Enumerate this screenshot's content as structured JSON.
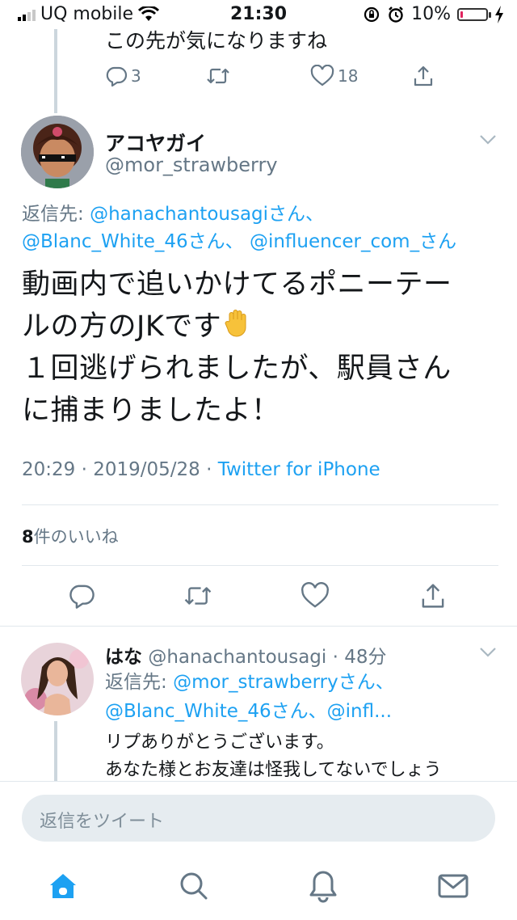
{
  "status_bar": {
    "carrier": "UQ mobile",
    "time": "21:30",
    "battery": "10%",
    "battery_level": 0.1
  },
  "prev_tweet": {
    "text": "この先が気になりますね",
    "reply_count": "3",
    "like_count": "18"
  },
  "main_tweet": {
    "display_name": "アコヤガイ",
    "handle": "@mor_strawberry",
    "reply_prefix": "返信先:",
    "reply_to_1": "@hanachantousagiさん、",
    "reply_to_2": "@Blanc_White_46さん、",
    "reply_to_3": "@influencer_com_さん",
    "text_line_1": "動画内で追いかけてるポニーテー",
    "text_line_2": "ルの方のJKです",
    "text_line_3": "１回逃げられましたが、駅員さん",
    "text_line_4": "に捕まりましたよ！",
    "timestamp": "20:29 · 2019/05/28 · ",
    "source": "Twitter for iPhone",
    "likes_count": "8",
    "likes_label": "件のいいね"
  },
  "reply_tweet": {
    "display_name": "はな",
    "handle_time": "@hanachantousagi · 48分",
    "reply_prefix": "返信先:",
    "reply_to_1": "@mor_strawberryさん、",
    "reply_to_2": "@Blanc_White_46さん、@infl...",
    "text_line_1": "リプありがとうございます。",
    "text_line_2": "あなた様とお友達は怪我してないでしょう"
  },
  "composer": {
    "placeholder": "返信をツイート"
  },
  "tab_bar": {
    "items": [
      "home-icon",
      "search-icon",
      "notifications-icon",
      "messages-icon"
    ]
  },
  "colors": {
    "accent": "#1da1f2",
    "muted": "#657786",
    "divider": "#e1e8ed"
  }
}
